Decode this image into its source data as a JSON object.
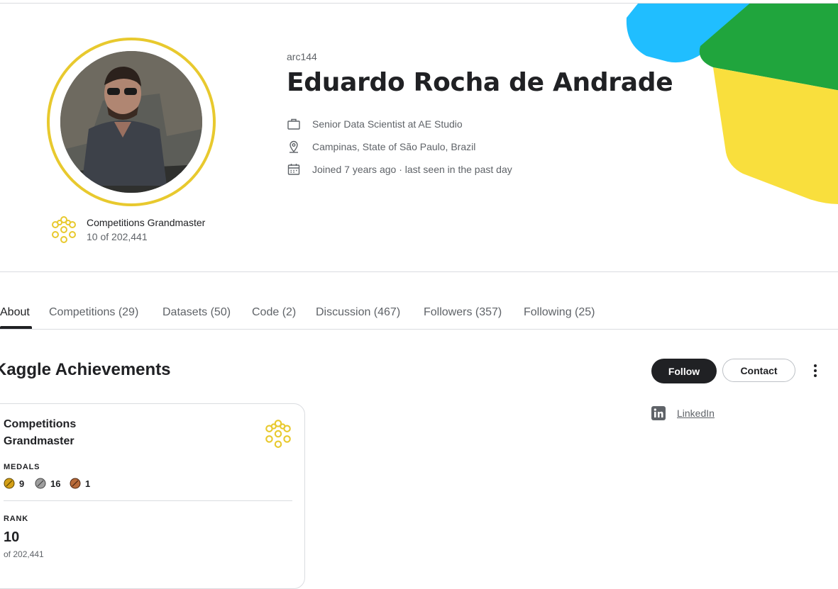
{
  "profile": {
    "username": "arc144",
    "full_name": "Eduardo Rocha de Andrade",
    "tier": {
      "title": "Competitions Grandmaster",
      "rank_text": "10 of 202,441",
      "icon": "grandmaster-tier-icon"
    },
    "details": [
      {
        "icon": "briefcase-icon",
        "text": "Senior Data Scientist at AE Studio"
      },
      {
        "icon": "location-pin-icon",
        "text": "Campinas, State of São Paulo, Brazil"
      },
      {
        "icon": "calendar-icon",
        "text": "Joined 7 years ago · last seen in the past day"
      }
    ],
    "accent_colors": {
      "ring": "#e8c92e",
      "blue": "#20beff",
      "green": "#20a53d",
      "yellow": "#f9df3d"
    }
  },
  "tabs": [
    {
      "label": "About",
      "active": true
    },
    {
      "label": "Competitions (29)"
    },
    {
      "label": "Datasets (50)"
    },
    {
      "label": "Code (2)"
    },
    {
      "label": "Discussion (467)"
    },
    {
      "label": "Followers (357)"
    },
    {
      "label": "Following (25)"
    }
  ],
  "achievements": {
    "section_title": "Kaggle Achievements",
    "card": {
      "title": "Competitions Grandmaster",
      "medals_label": "MEDALS",
      "medals": [
        {
          "type": "gold",
          "count": "9",
          "color": "#d4a017"
        },
        {
          "type": "silver",
          "count": "16",
          "color": "#9e9e9e"
        },
        {
          "type": "bronze",
          "count": "1",
          "color": "#b86b3a"
        }
      ],
      "rank_label": "RANK",
      "rank_value": "10",
      "rank_of": "of 202,441"
    }
  },
  "actions": {
    "follow_label": "Follow",
    "contact_label": "Contact",
    "more_icon": "more-vertical-icon"
  },
  "links": [
    {
      "icon": "linkedin-icon",
      "label": "LinkedIn"
    }
  ]
}
